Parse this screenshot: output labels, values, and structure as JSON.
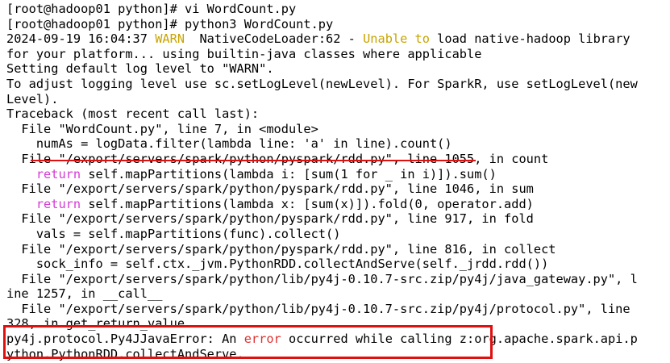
{
  "colors": {
    "background": "#ffffff",
    "text": "#000000",
    "warn": "#c8a400",
    "keyword": "#d63ad6",
    "error": "#e03030",
    "annotation": "#e01010"
  },
  "terminal": {
    "l1": "[root@hadoop01 python]# vi WordCount.py",
    "l2": "[root@hadoop01 python]# python3 WordCount.py",
    "l3": {
      "a": "2024-09-19 16:04:37 ",
      "b": "WARN",
      "c": "  NativeCodeLoader:62 - ",
      "d": "Unable to",
      "e": " load native-hadoop library"
    },
    "l4": "for your platform... using builtin-java classes where applicable",
    "l5": "Setting default log level to \"WARN\".",
    "l6": "To adjust logging level use sc.setLogLevel(newLevel). For SparkR, use setLogLevel(new",
    "l7": "Level).",
    "l8": "Traceback (most recent call last):",
    "l9": "  File \"WordCount.py\", line 7, in <module>",
    "l10": "    numAs = logData.filter(lambda line: 'a' in line).count()",
    "l11": "  File \"/export/servers/spark/python/pyspark/rdd.py\", line 1055, in count",
    "l12": {
      "pre": "    ",
      "kw": "return",
      "post": " self.mapPartitions(lambda i: [sum(1 for _ in i)]).sum()"
    },
    "l13": "  File \"/export/servers/spark/python/pyspark/rdd.py\", line 1046, in sum",
    "l14": {
      "pre": "    ",
      "kw": "return",
      "post": " self.mapPartitions(lambda x: [sum(x)]).fold(0, operator.add)"
    },
    "l15": "  File \"/export/servers/spark/python/pyspark/rdd.py\", line 917, in fold",
    "l16": "    vals = self.mapPartitions(func).collect()",
    "l17": "  File \"/export/servers/spark/python/pyspark/rdd.py\", line 816, in collect",
    "l18": "    sock_info = self.ctx._jvm.PythonRDD.collectAndServe(self._jrdd.rdd())",
    "l19": "  File \"/export/servers/spark/python/lib/py4j-0.10.7-src.zip/py4j/java_gateway.py\", l",
    "l20": "ine 1257, in __call__",
    "l21": "  File \"/export/servers/spark/python/lib/py4j-0.10.7-src.zip/py4j/protocol.py\", line",
    "l22": "328, in get_return_value",
    "l23": {
      "a": "py4j.protocol.Py4JJavaError: An ",
      "b": "error",
      "c": " occurred while calling z:org.apache.spark.api.p"
    },
    "l24": "ython.PythonRDD.collectAndServe."
  }
}
